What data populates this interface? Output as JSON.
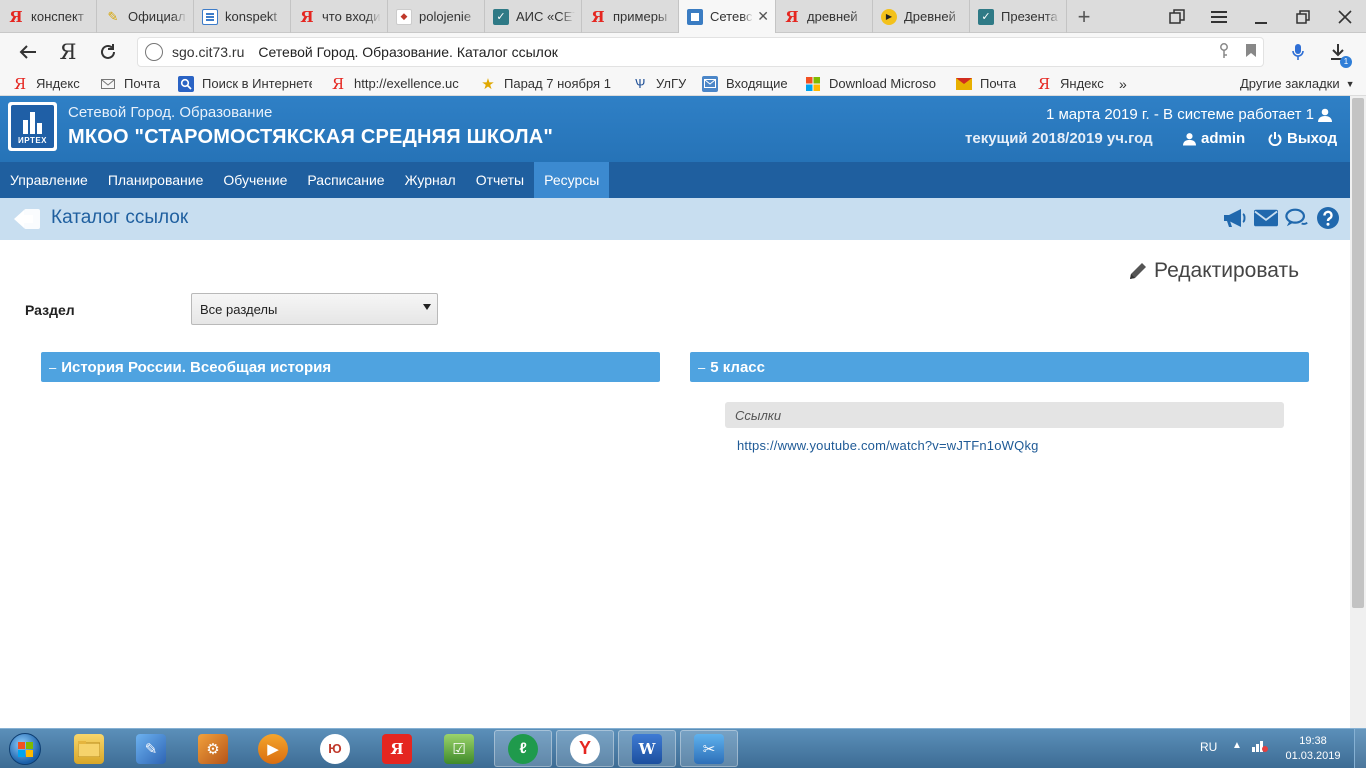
{
  "browser": {
    "tabs": [
      {
        "label": "конспект",
        "favicon": "yandex-icon"
      },
      {
        "label": "Официал",
        "favicon": "pencil-icon"
      },
      {
        "label": "konspekt",
        "favicon": "document-icon"
      },
      {
        "label": "что входи",
        "favicon": "yandex-icon"
      },
      {
        "label": "polojenie",
        "favicon": "doc-red-icon"
      },
      {
        "label": "АИС «СЕТ",
        "favicon": "check-icon"
      },
      {
        "label": "примеры",
        "favicon": "yandex-icon"
      },
      {
        "label": "Сетевс",
        "favicon": "sgo-icon",
        "active": true
      },
      {
        "label": "древней",
        "favicon": "yandex-icon"
      },
      {
        "label": "Древней",
        "favicon": "play-icon"
      },
      {
        "label": "Презента",
        "favicon": "check-icon"
      }
    ],
    "new_tab": "+",
    "address": {
      "domain": "sgo.cit73.ru",
      "page_title": "Сетевой Город. Образование. Каталог ссылок"
    },
    "downloads_badge": "1",
    "bookmarks": [
      {
        "label": "Яндекс",
        "icon": "yandex-icon"
      },
      {
        "label": "Почта",
        "icon": "mail-icon"
      },
      {
        "label": "Поиск в Интернете",
        "icon": "search-icon"
      },
      {
        "label": "http://exellence.uc",
        "icon": "yandex-icon"
      },
      {
        "label": "Парад 7 ноября 1",
        "icon": "star-icon"
      },
      {
        "label": "УлГУ",
        "icon": "ulgu-icon"
      },
      {
        "label": "Входящие",
        "icon": "inbox-icon"
      },
      {
        "label": "Download Microso",
        "icon": "microsoft-icon"
      },
      {
        "label": "Почта",
        "icon": "envelope-icon"
      },
      {
        "label": "Яндекс",
        "icon": "yandex-icon"
      }
    ],
    "bookmarks_more": "»",
    "other_bookmarks": "Другие закладки"
  },
  "site": {
    "logo_text": "ИРТЕХ",
    "subtitle": "Сетевой Город. Образование",
    "school": "МКОО \"СТАРОМОСТЯКСКАЯ СРЕДНЯЯ ШКОЛА\"",
    "status": "1 марта 2019 г. - В системе работает 1",
    "year": "текущий 2018/2019 уч.год",
    "user": "admin",
    "logout": "Выход"
  },
  "menu": [
    {
      "label": "Управление"
    },
    {
      "label": "Планирование"
    },
    {
      "label": "Обучение"
    },
    {
      "label": "Расписание"
    },
    {
      "label": "Журнал"
    },
    {
      "label": "Отчеты"
    },
    {
      "label": "Ресурсы",
      "active": true
    }
  ],
  "page": {
    "title": "Каталог ссылок",
    "edit_label": "Редактировать",
    "section_label": "Раздел",
    "section_value": "Все разделы",
    "panel_left": "История России. Всеобщая история",
    "panel_right": "5 класс",
    "collapse_symbol": "–",
    "links_header": "Ссылки",
    "link_url": "https://www.youtube.com/watch?v=wJTFn1oWQkg"
  },
  "taskbar": {
    "lang": "RU",
    "time": "19:38",
    "date": "01.03.2019"
  },
  "colors": {
    "header_blue": "#2a78bd",
    "menu_blue": "#1f5f9f",
    "menu_active": "#3c8ad0",
    "subheader_bg": "#c8def0",
    "panel_blue": "#4fa3e0",
    "link_color": "#1f5a96"
  }
}
